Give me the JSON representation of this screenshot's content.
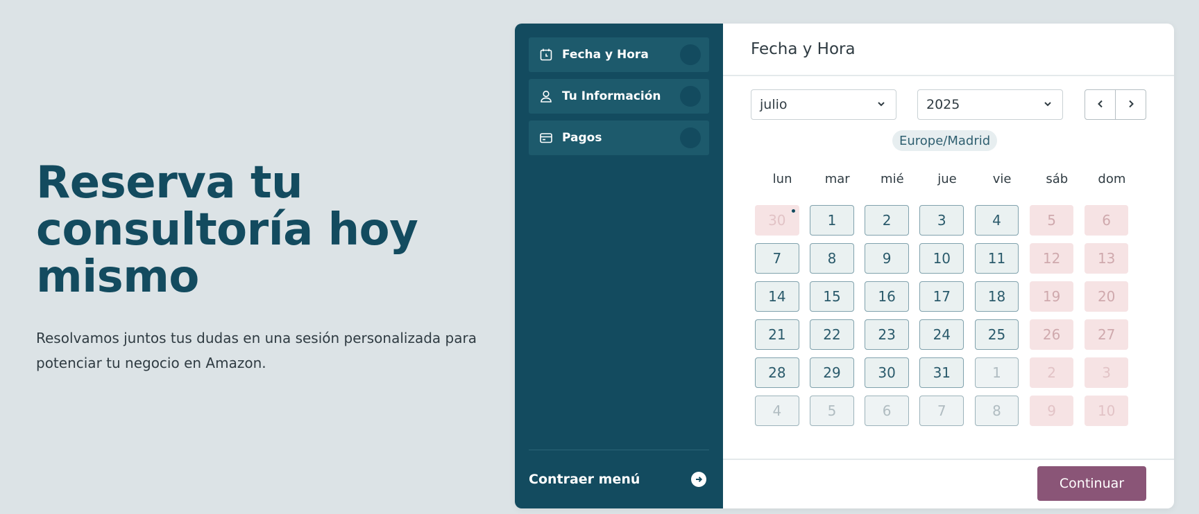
{
  "hero": {
    "title": "Reserva tu consultoría hoy mismo",
    "subtitle": "Resolvamos juntos tus dudas en una sesión personalizada para potenciar tu negocio en Amazon."
  },
  "sidebar": {
    "items": [
      {
        "label": "Fecha y Hora",
        "icon": "calendar-clock-icon"
      },
      {
        "label": "Tu Información",
        "icon": "user-icon"
      },
      {
        "label": "Pagos",
        "icon": "credit-card-icon"
      }
    ],
    "collapse_label": "Contraer menú",
    "collapse_icon": "arrow-right-circle-icon"
  },
  "main": {
    "title": "Fecha y Hora",
    "month": "julio",
    "year": "2025",
    "timezone": "Europe/Madrid",
    "continue_label": "Continuar"
  },
  "calendar": {
    "weekdays": [
      "lun",
      "mar",
      "mié",
      "jue",
      "vie",
      "sáb",
      "dom"
    ],
    "weeks": [
      [
        {
          "d": "30",
          "s": "past",
          "today": true
        },
        {
          "d": "1",
          "s": "avail"
        },
        {
          "d": "2",
          "s": "avail"
        },
        {
          "d": "3",
          "s": "avail"
        },
        {
          "d": "4",
          "s": "avail"
        },
        {
          "d": "5",
          "s": "weekend"
        },
        {
          "d": "6",
          "s": "weekend"
        }
      ],
      [
        {
          "d": "7",
          "s": "avail"
        },
        {
          "d": "8",
          "s": "avail"
        },
        {
          "d": "9",
          "s": "avail"
        },
        {
          "d": "10",
          "s": "avail"
        },
        {
          "d": "11",
          "s": "avail"
        },
        {
          "d": "12",
          "s": "weekend"
        },
        {
          "d": "13",
          "s": "weekend"
        }
      ],
      [
        {
          "d": "14",
          "s": "avail"
        },
        {
          "d": "15",
          "s": "avail"
        },
        {
          "d": "16",
          "s": "avail"
        },
        {
          "d": "17",
          "s": "avail"
        },
        {
          "d": "18",
          "s": "avail"
        },
        {
          "d": "19",
          "s": "weekend"
        },
        {
          "d": "20",
          "s": "weekend"
        }
      ],
      [
        {
          "d": "21",
          "s": "avail"
        },
        {
          "d": "22",
          "s": "avail"
        },
        {
          "d": "23",
          "s": "avail"
        },
        {
          "d": "24",
          "s": "avail"
        },
        {
          "d": "25",
          "s": "avail"
        },
        {
          "d": "26",
          "s": "weekend"
        },
        {
          "d": "27",
          "s": "weekend"
        }
      ],
      [
        {
          "d": "28",
          "s": "avail"
        },
        {
          "d": "29",
          "s": "avail"
        },
        {
          "d": "30",
          "s": "avail"
        },
        {
          "d": "31",
          "s": "avail"
        },
        {
          "d": "1",
          "s": "muted"
        },
        {
          "d": "2",
          "s": "past"
        },
        {
          "d": "3",
          "s": "past"
        }
      ],
      [
        {
          "d": "4",
          "s": "muted"
        },
        {
          "d": "5",
          "s": "muted"
        },
        {
          "d": "6",
          "s": "muted"
        },
        {
          "d": "7",
          "s": "muted"
        },
        {
          "d": "8",
          "s": "muted"
        },
        {
          "d": "9",
          "s": "past"
        },
        {
          "d": "10",
          "s": "past"
        }
      ]
    ]
  },
  "colors": {
    "brand": "#134b5f",
    "accent": "#8a5577",
    "background": "#dce3e6"
  }
}
